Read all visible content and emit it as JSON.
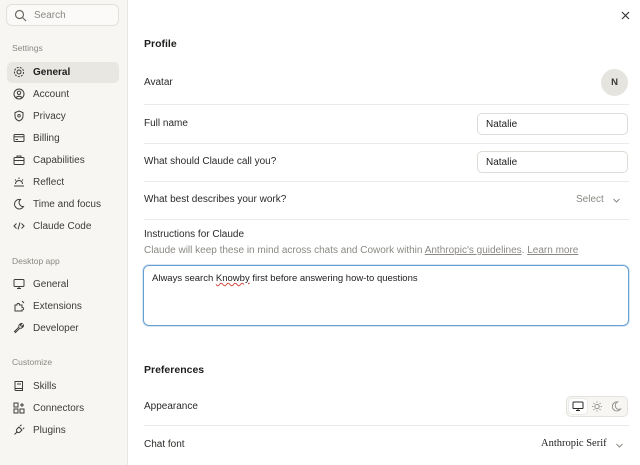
{
  "sidebar": {
    "search_placeholder": "Search",
    "sections": [
      {
        "label": "Settings",
        "items": [
          {
            "label": "General",
            "icon": "gear-icon",
            "active": true
          },
          {
            "label": "Account",
            "icon": "user-circle-icon"
          },
          {
            "label": "Privacy",
            "icon": "shield-icon"
          },
          {
            "label": "Billing",
            "icon": "credit-card-icon"
          },
          {
            "label": "Capabilities",
            "icon": "briefcase-icon"
          },
          {
            "label": "Reflect",
            "icon": "sunrise-icon"
          },
          {
            "label": "Time and focus",
            "icon": "moon-clock-icon"
          },
          {
            "label": "Claude Code",
            "icon": "code-icon"
          }
        ]
      },
      {
        "label": "Desktop app",
        "items": [
          {
            "label": "General",
            "icon": "monitor-icon"
          },
          {
            "label": "Extensions",
            "icon": "puzzle-icon"
          },
          {
            "label": "Developer",
            "icon": "wrench-icon"
          }
        ]
      },
      {
        "label": "Customize",
        "items": [
          {
            "label": "Skills",
            "icon": "book-icon"
          },
          {
            "label": "Connectors",
            "icon": "grid-plus-icon"
          },
          {
            "label": "Plugins",
            "icon": "plug-icon"
          }
        ]
      }
    ]
  },
  "main": {
    "profile_heading": "Profile",
    "avatar_label": "Avatar",
    "avatar_initial": "N",
    "full_name_label": "Full name",
    "full_name_value": "Natalie",
    "call_you_label": "What should Claude call you?",
    "call_you_value": "Natalie",
    "work_label": "What best describes your work?",
    "work_select": "Select",
    "instructions_label": "Instructions for Claude",
    "instructions_hint_prefix": "Claude will keep these in mind across chats and Cowork within ",
    "instructions_hint_link1": "Anthropic's guidelines",
    "instructions_hint_sep": ". ",
    "instructions_hint_link2": "Learn more",
    "instructions_text_a": "Always search ",
    "instructions_text_err": "Knowby",
    "instructions_text_b": " first before answering how-to questions",
    "preferences_heading": "Preferences",
    "appearance_label": "Appearance",
    "appearance_selected": "system",
    "chat_font_label": "Chat font",
    "chat_font_value": "Anthropic Serif"
  },
  "colors": {
    "sidebar_bg": "#f7f6f3",
    "active_item_bg": "#e9e7e2",
    "focus_border": "#6a9fd1"
  }
}
